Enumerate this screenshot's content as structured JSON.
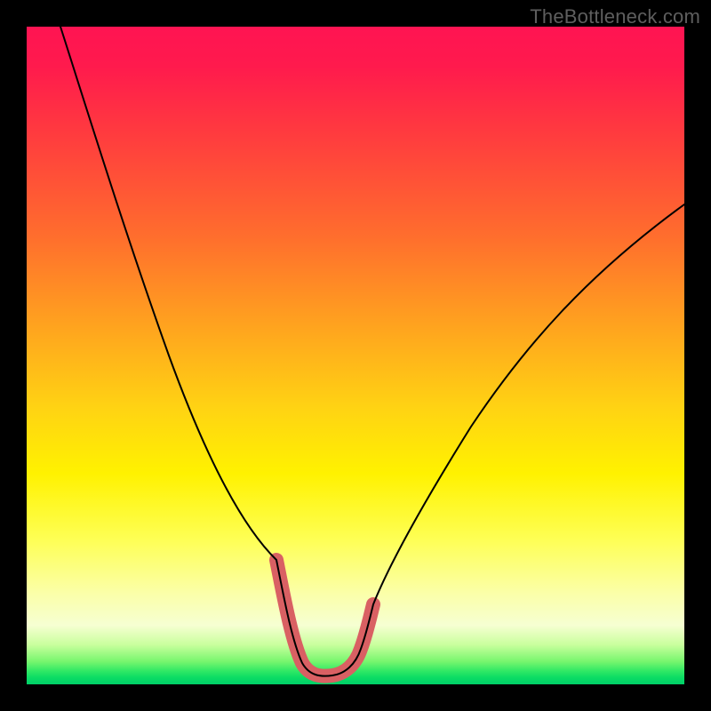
{
  "watermark": "TheBottleneck.com",
  "colors": {
    "background": "#000000",
    "curve_thin": "#000000",
    "curve_thick": "#d96063",
    "gradient_top": "#ff1452",
    "gradient_bottom": "#00cf68"
  },
  "chart_data": {
    "type": "line",
    "title": "",
    "xlabel": "",
    "ylabel": "",
    "xlim": [
      0,
      100
    ],
    "ylim": [
      0,
      100
    ],
    "series": [
      {
        "name": "bottleneck-curve",
        "x": [
          5,
          10,
          15,
          20,
          25,
          30,
          35,
          38,
          40,
          42,
          44,
          46,
          48,
          50,
          55,
          60,
          65,
          70,
          75,
          80,
          85,
          90,
          95,
          100
        ],
        "values": [
          100,
          88,
          76,
          64,
          52,
          40,
          28,
          19,
          12,
          6,
          3,
          2,
          2,
          3,
          9,
          18,
          27,
          35,
          43,
          50,
          57,
          63,
          68,
          73
        ]
      }
    ],
    "highlight_range_x": [
      38,
      52
    ],
    "notes": "V-shaped bottleneck curve over a vertical red-to-green gradient. x is relative horizontal position (0–100 across the plot), y is relative vertical position measured from the bottom (0 = bottom green edge, 100 = top red edge). The thick muted-red segment highlights the valley floor roughly between x=38 and x=52. No axis ticks, labels, grid, or legend are rendered; only the watermark 'TheBottleneck.com' in the upper-right corner."
  }
}
